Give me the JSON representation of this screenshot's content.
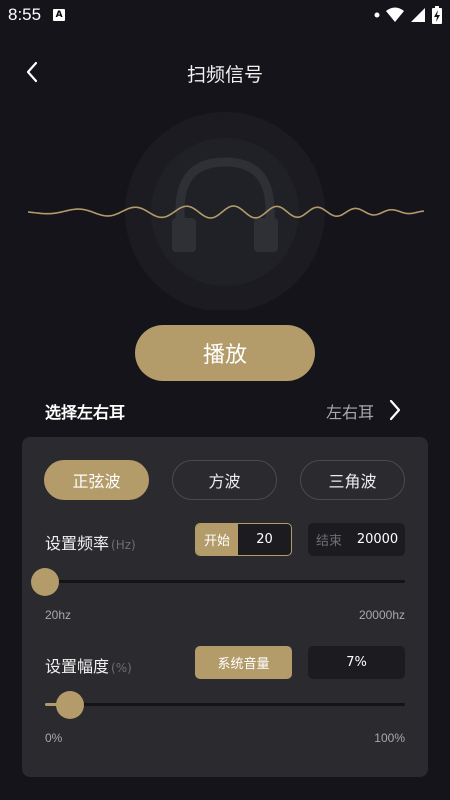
{
  "status": {
    "time": "8:55",
    "notification_icon": "A"
  },
  "header": {
    "title": "扫频信号"
  },
  "play_button": {
    "label": "播放"
  },
  "ear_select": {
    "label": "选择左右耳",
    "value": "左右耳"
  },
  "wave_types": {
    "items": [
      {
        "label": "正弦波",
        "active": true
      },
      {
        "label": "方波",
        "active": false
      },
      {
        "label": "三角波",
        "active": false
      }
    ]
  },
  "frequency": {
    "label": "设置频率",
    "unit": "(Hz)",
    "start_tag": "开始",
    "start_value": "20",
    "end_tag": "结束",
    "end_value": "20000",
    "slider_value": 0,
    "min_label": "20hz",
    "max_label": "20000hz"
  },
  "amplitude": {
    "label": "设置幅度",
    "unit": "(%)",
    "button": "系统音量",
    "value": "7%",
    "slider_value": 7,
    "min_label": "0%",
    "max_label": "100%"
  },
  "colors": {
    "accent": "#b39b6a",
    "background": "#14141a",
    "panel": "#2a2a2f"
  }
}
